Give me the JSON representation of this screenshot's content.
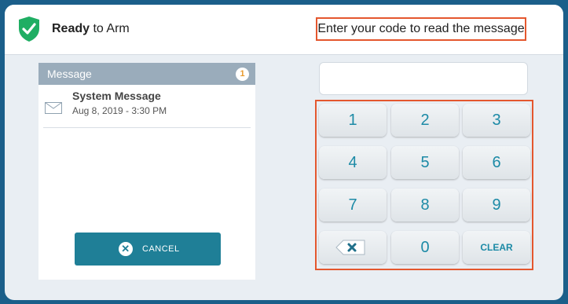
{
  "header": {
    "status_bold": "Ready",
    "status_rest": "to Arm",
    "prompt": "Enter your code to read the message"
  },
  "messages": {
    "title": "Message",
    "count": "1",
    "items": [
      {
        "title": "System Message",
        "date": "Aug 8, 2019 - 3:30 PM"
      }
    ],
    "cancel_label": "CANCEL"
  },
  "code_input": {
    "value": ""
  },
  "keypad": {
    "keys": [
      "1",
      "2",
      "3",
      "4",
      "5",
      "6",
      "7",
      "8",
      "9",
      "",
      "0",
      "CLEAR"
    ]
  },
  "colors": {
    "accent": "#1f7f97",
    "shield": "#1fae63",
    "highlight": "#e4572e",
    "badge": "#e89a2d"
  }
}
